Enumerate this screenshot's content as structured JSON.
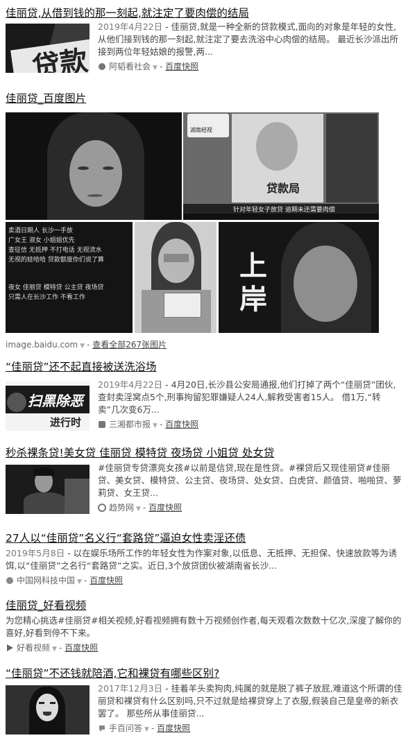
{
  "results": [
    {
      "title": "佳丽贷,从借到钱的那一刻起,就注定了要肉偿的结局",
      "date": "2019年4月22日",
      "abstract": " - 佳丽贷,就是一种全新的贷款模式,面向的对象是年轻的女性,从他们接到钱的那一刻起,就注定了要去洗浴中心肉偿的结局。 最近长沙派出所接到两位年轻姑娘的报警,两...",
      "source": "阿韬看社会",
      "snapshot": "百度快照",
      "thumb_text": "贷款"
    },
    {
      "title": "佳丽贷_百度图片",
      "source": "image.baidu.com",
      "more": "查看全部267张图片",
      "img_text_1": "湖南经视",
      "img_text_2": "贷款局",
      "img_text_3": "针对年轻女子放贷 逾期未还需要肉偿",
      "img_text_4": "上岸",
      "img_lines": [
        "卖酒日期人 长沙一手放",
        "广女王 淑女 小姐姐优先",
        "查征信 无抵押 不打电话 无视流水",
        "无视的娃哈哈 贷款额度你们说了算",
        "夜女 佳丽贷 模特贷 公主贷 夜场贷",
        "只需人在长沙工作 不看工作 "
      ]
    },
    {
      "title": "“佳丽贷”还不起直接被送洗浴场",
      "date": "2019年4月22日",
      "abstract": " - 4月20日,长沙县公安局通报,他们打掉了两个“佳丽贷”团伙,查封卖淫窝点5个,刑事拘留犯罪嫌疑人24人,解救受害者15人。 借1万,“转卖”几次变6万...",
      "source": "三湘都市报",
      "snapshot": "百度快照",
      "thumb_text": "扫黑除恶",
      "thumb_text2": "进行时"
    },
    {
      "title": "秒杀裸条贷!美女贷 佳丽贷 模特贷 夜场贷 小姐贷 处女贷",
      "abstract": "#佳丽贷专贷漂亮女孩#以前是信贷,现在是性贷。#裸贷后又现佳丽贷#佳丽贷、美女贷、模特贷、公主贷、夜场贷、处女贷、白虎贷、颜值贷、啪啪贷、萝莉贷、女王贷...",
      "source": "趋势网",
      "snapshot": "百度快照"
    },
    {
      "title": "27人以“佳丽贷”名义行“套路贷”逼迫女性卖淫还债",
      "date": "2019年5月8日",
      "abstract": " - 以在娱乐场所工作的年轻女性为作案对象,以低息、无抵押、无担保、快速放款等为诱饵,以“佳丽贷”之名行“套路贷”之实。近日,3个放贷团伙被湖南省长沙...",
      "source": "中国网科技中国",
      "snapshot": "百度快照"
    },
    {
      "title": "佳丽贷_好看视频",
      "abstract": "为您精心挑选#佳丽贷#相关视频,好看视频拥有数十万视频创作者,每天观看次数数十亿次,深度了解你的喜好,好看到停不下来。",
      "source": "好看视频",
      "snapshot": "百度快照"
    },
    {
      "title": "“佳丽贷”不还钱就陪酒,它和裸贷有哪些区别?",
      "date": "2017年12月3日",
      "abstract": " - 挂着羊头卖狗肉,纯属的就是脱了裤子放屁,难道这个所谓的佳丽贷和裸贷有什么区别吗,只不过就是给裸贷穿上了衣服,假装自己是皇帝的新衣罢了。 那些所从事佳丽贷...",
      "source": "手百问答",
      "snapshot": "百度快照"
    }
  ]
}
